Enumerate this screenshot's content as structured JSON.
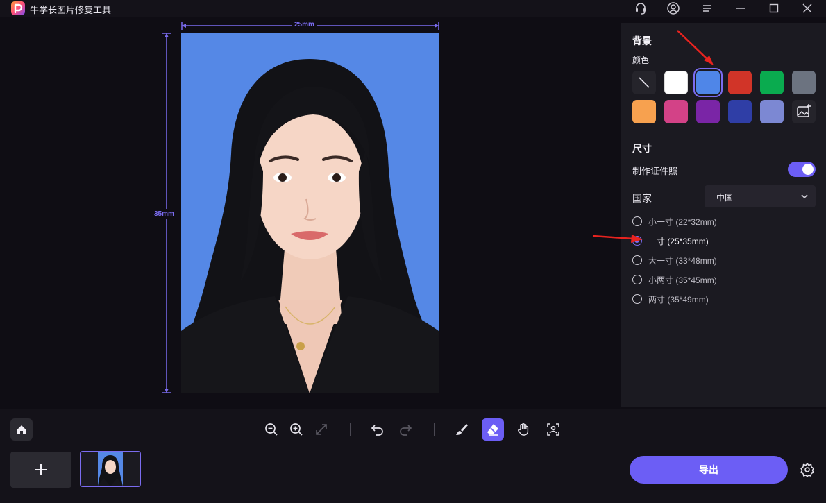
{
  "window": {
    "title": "牛学长图片修复工具"
  },
  "canvas": {
    "width_label": "25mm",
    "height_label": "35mm"
  },
  "panel": {
    "background_title": "背景",
    "color_label": "颜色",
    "swatches": [
      {
        "name": "none",
        "color": "#25242b"
      },
      {
        "name": "white",
        "color": "#ffffff"
      },
      {
        "name": "blue",
        "color": "#4f86e8",
        "selected": true
      },
      {
        "name": "red",
        "color": "#d13428"
      },
      {
        "name": "green",
        "color": "#0aab4f"
      },
      {
        "name": "gray",
        "color": "#6c7380"
      },
      {
        "name": "orange",
        "color": "#f7a14f"
      },
      {
        "name": "pink",
        "color": "#d34287"
      },
      {
        "name": "purple",
        "color": "#7a25a6"
      },
      {
        "name": "navy",
        "color": "#2f3ea6"
      },
      {
        "name": "lavender",
        "color": "#7c88d3"
      },
      {
        "name": "custom-image",
        "color": "#25242b"
      }
    ],
    "size_title": "尺寸",
    "id_photo_label": "制作证件照",
    "id_photo_enabled": true,
    "country_label": "国家",
    "country_value": "中国",
    "size_options": [
      {
        "label": "小一寸 (22*32mm)",
        "checked": false
      },
      {
        "label": "一寸 (25*35mm)",
        "checked": true
      },
      {
        "label": "大一寸 (33*48mm)",
        "checked": false
      },
      {
        "label": "小两寸 (35*45mm)",
        "checked": false
      },
      {
        "label": "两寸 (35*49mm)",
        "checked": false
      }
    ]
  },
  "bottom": {
    "export_label": "导出"
  },
  "colors": {
    "accent": "#6c5ef5",
    "photo_background": "#5588e6"
  }
}
